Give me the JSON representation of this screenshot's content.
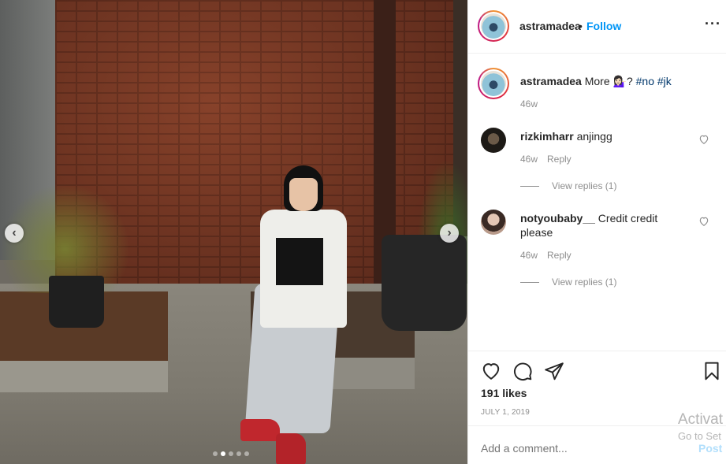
{
  "header": {
    "username": "astramadea",
    "separator": "•",
    "follow_label": "Follow",
    "more_label": "···"
  },
  "caption": {
    "username": "astramadea",
    "text_before": "More ",
    "emoji": "💁🏻‍♀️",
    "text_after": "? ",
    "hashtags": [
      "#no",
      "#jk"
    ],
    "time": "46w"
  },
  "comments": [
    {
      "username": "rizkimharr",
      "text": "anjingg",
      "time": "46w",
      "reply_label": "Reply",
      "view_replies_label": "View replies (1)"
    },
    {
      "username": "notyoubaby__",
      "text": "Credit credit please",
      "time": "46w",
      "reply_label": "Reply",
      "view_replies_label": "View replies (1)"
    }
  ],
  "actions": {
    "icons": [
      "heart-icon",
      "comment-icon",
      "share-icon",
      "bookmark-icon"
    ],
    "likes": "191 likes",
    "date": "JULY 1, 2019"
  },
  "add_comment": {
    "placeholder": "Add a comment...",
    "post_label": "Post"
  },
  "carousel": {
    "slide_count": 5,
    "active_index": 1
  },
  "watermark": {
    "line1": "Activat",
    "line2": "Go to Set"
  },
  "colors": {
    "link": "#0095f6",
    "hashtag": "#00376b",
    "muted": "#8e8e8e"
  }
}
